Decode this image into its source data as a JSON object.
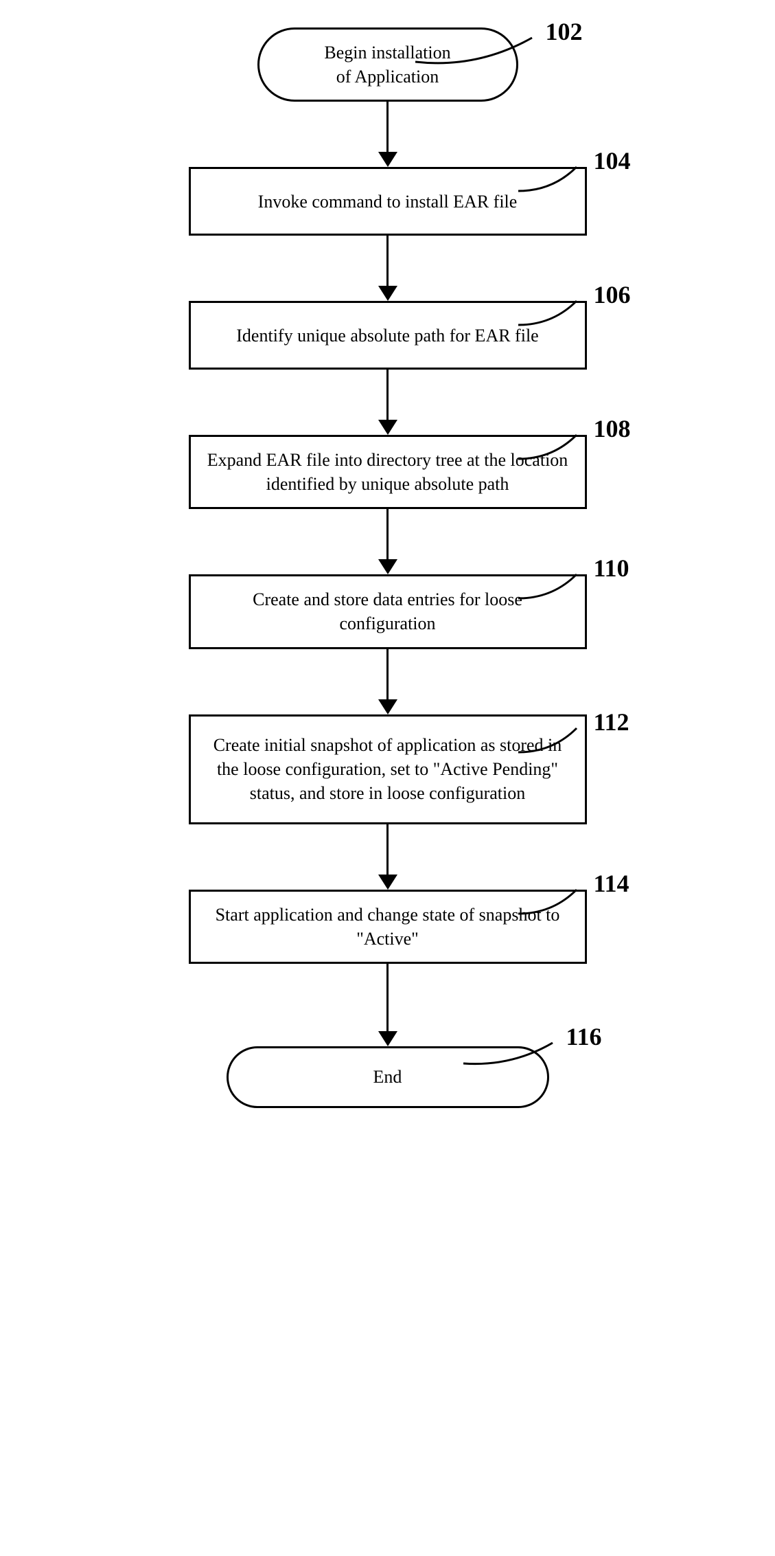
{
  "flowchart": {
    "nodes": [
      {
        "id": "n102",
        "type": "terminator",
        "label": "102",
        "text": "Begin installation\nof Application"
      },
      {
        "id": "n104",
        "type": "process",
        "label": "104",
        "text": "Invoke command to install EAR file"
      },
      {
        "id": "n106",
        "type": "process",
        "label": "106",
        "text": "Identify unique absolute path for EAR file"
      },
      {
        "id": "n108",
        "type": "process",
        "label": "108",
        "text": "Expand EAR file into directory tree at the location identified by unique absolute path"
      },
      {
        "id": "n110",
        "type": "process",
        "label": "110",
        "text": "Create and store data entries for loose configuration"
      },
      {
        "id": "n112",
        "type": "process",
        "label": "112",
        "text": "Create initial snapshot of application as stored in the loose configuration, set to \"Active Pending\" status, and store in loose configuration"
      },
      {
        "id": "n114",
        "type": "process",
        "label": "114",
        "text": "Start application and change state of snapshot to \"Active\""
      },
      {
        "id": "n116",
        "type": "terminator",
        "label": "116",
        "text": "End"
      }
    ]
  }
}
